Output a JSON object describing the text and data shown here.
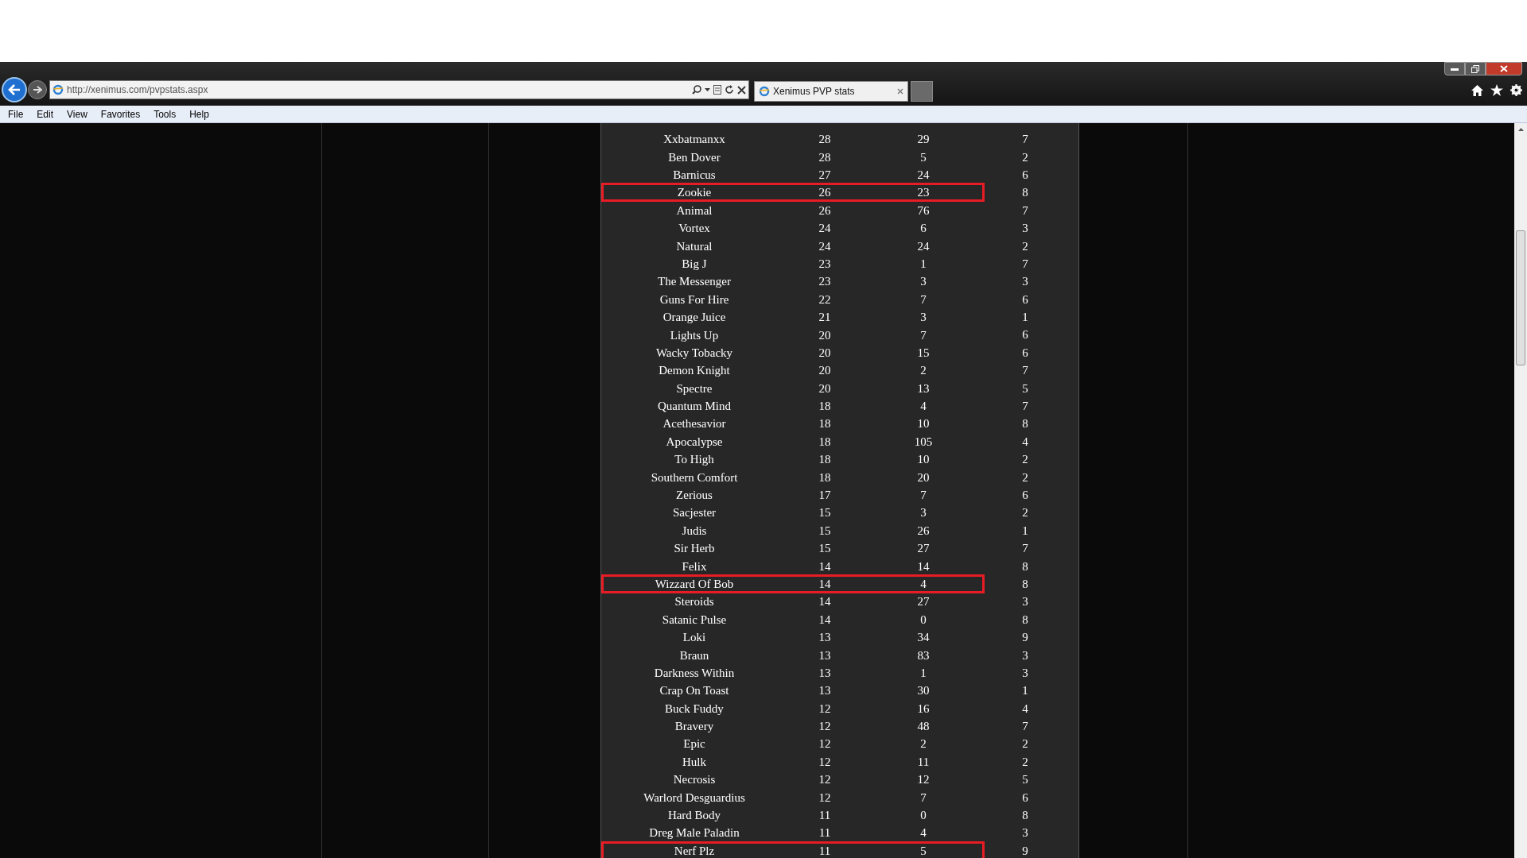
{
  "browser": {
    "address": "http://xenimus.com/pvpstats.aspx",
    "tab_title": "Xenimus PVP stats"
  },
  "menu": [
    "File",
    "Edit",
    "View",
    "Favorites",
    "Tools",
    "Help"
  ],
  "table": {
    "rows": [
      {
        "cells": [
          "Xxbatmanxx",
          "28",
          "29",
          "7"
        ],
        "highlighted": false
      },
      {
        "cells": [
          "Ben Dover",
          "28",
          "5",
          "2"
        ],
        "highlighted": false
      },
      {
        "cells": [
          "Barnicus",
          "27",
          "24",
          "6"
        ],
        "highlighted": false
      },
      {
        "cells": [
          "Zookie",
          "26",
          "23",
          "8"
        ],
        "highlighted": true
      },
      {
        "cells": [
          "Animal",
          "26",
          "76",
          "7"
        ],
        "highlighted": false
      },
      {
        "cells": [
          "Vortex",
          "24",
          "6",
          "3"
        ],
        "highlighted": false
      },
      {
        "cells": [
          "Natural",
          "24",
          "24",
          "2"
        ],
        "highlighted": false
      },
      {
        "cells": [
          "Big J",
          "23",
          "1",
          "7"
        ],
        "highlighted": false
      },
      {
        "cells": [
          "The Messenger",
          "23",
          "3",
          "3"
        ],
        "highlighted": false
      },
      {
        "cells": [
          "Guns For Hire",
          "22",
          "7",
          "6"
        ],
        "highlighted": false
      },
      {
        "cells": [
          "Orange Juice",
          "21",
          "3",
          "1"
        ],
        "highlighted": false
      },
      {
        "cells": [
          "Lights Up",
          "20",
          "7",
          "6"
        ],
        "highlighted": false
      },
      {
        "cells": [
          "Wacky Tobacky",
          "20",
          "15",
          "6"
        ],
        "highlighted": false
      },
      {
        "cells": [
          "Demon Knight",
          "20",
          "2",
          "7"
        ],
        "highlighted": false
      },
      {
        "cells": [
          "Spectre",
          "20",
          "13",
          "5"
        ],
        "highlighted": false
      },
      {
        "cells": [
          "Quantum Mind",
          "18",
          "4",
          "7"
        ],
        "highlighted": false
      },
      {
        "cells": [
          "Acethesavior",
          "18",
          "10",
          "8"
        ],
        "highlighted": false
      },
      {
        "cells": [
          "Apocalypse",
          "18",
          "105",
          "4"
        ],
        "highlighted": false
      },
      {
        "cells": [
          "To High",
          "18",
          "10",
          "2"
        ],
        "highlighted": false
      },
      {
        "cells": [
          "Southern Comfort",
          "18",
          "20",
          "2"
        ],
        "highlighted": false
      },
      {
        "cells": [
          "Zerious",
          "17",
          "7",
          "6"
        ],
        "highlighted": false
      },
      {
        "cells": [
          "Sacjester",
          "15",
          "3",
          "2"
        ],
        "highlighted": false
      },
      {
        "cells": [
          "Judis",
          "15",
          "26",
          "1"
        ],
        "highlighted": false
      },
      {
        "cells": [
          "Sir Herb",
          "15",
          "27",
          "7"
        ],
        "highlighted": false
      },
      {
        "cells": [
          "Felix",
          "14",
          "14",
          "8"
        ],
        "highlighted": false
      },
      {
        "cells": [
          "Wizzard Of Bob",
          "14",
          "4",
          "8"
        ],
        "highlighted": true
      },
      {
        "cells": [
          "Steroids",
          "14",
          "27",
          "3"
        ],
        "highlighted": false
      },
      {
        "cells": [
          "Satanic Pulse",
          "14",
          "0",
          "8"
        ],
        "highlighted": false
      },
      {
        "cells": [
          "Loki",
          "13",
          "34",
          "9"
        ],
        "highlighted": false
      },
      {
        "cells": [
          "Braun",
          "13",
          "83",
          "3"
        ],
        "highlighted": false
      },
      {
        "cells": [
          "Darkness Within",
          "13",
          "1",
          "3"
        ],
        "highlighted": false
      },
      {
        "cells": [
          "Crap On Toast",
          "13",
          "30",
          "1"
        ],
        "highlighted": false
      },
      {
        "cells": [
          "Buck Fuddy",
          "12",
          "16",
          "4"
        ],
        "highlighted": false
      },
      {
        "cells": [
          "Bravery",
          "12",
          "48",
          "7"
        ],
        "highlighted": false
      },
      {
        "cells": [
          "Epic",
          "12",
          "2",
          "2"
        ],
        "highlighted": false
      },
      {
        "cells": [
          "Hulk",
          "12",
          "11",
          "2"
        ],
        "highlighted": false
      },
      {
        "cells": [
          "Necrosis",
          "12",
          "12",
          "5"
        ],
        "highlighted": false
      },
      {
        "cells": [
          "Warlord Desguardius",
          "12",
          "7",
          "6"
        ],
        "highlighted": false
      },
      {
        "cells": [
          "Hard Body",
          "11",
          "0",
          "8"
        ],
        "highlighted": false
      },
      {
        "cells": [
          "Dreg Male Paladin",
          "11",
          "4",
          "3"
        ],
        "highlighted": false
      },
      {
        "cells": [
          "Nerf Plz",
          "11",
          "5",
          "9"
        ],
        "highlighted": true
      }
    ]
  }
}
